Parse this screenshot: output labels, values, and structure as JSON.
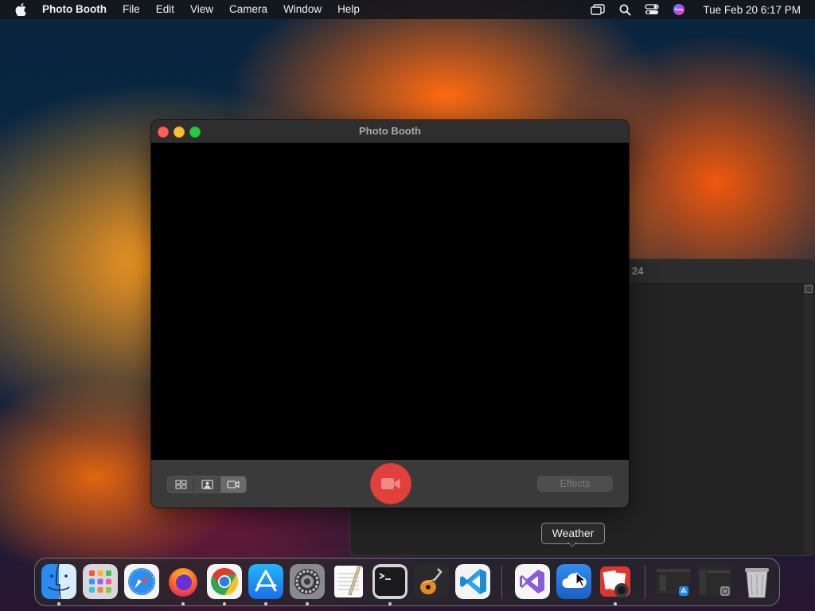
{
  "menubar": {
    "app_name": "Photo Booth",
    "menus": [
      "File",
      "Edit",
      "View",
      "Camera",
      "Window",
      "Help"
    ],
    "status_icons": [
      "screen-mirroring-icon",
      "search-icon",
      "control-center-icon",
      "siri-icon"
    ],
    "clock": "Tue Feb 20  6:17 PM"
  },
  "background_window": {
    "partial_title": "24"
  },
  "photo_booth": {
    "title": "Photo Booth",
    "modes": [
      {
        "name": "four-up-photo",
        "icon": "grid-icon",
        "active": false
      },
      {
        "name": "single-photo",
        "icon": "portrait-icon",
        "active": false
      },
      {
        "name": "video",
        "icon": "video-camera-icon",
        "active": true
      }
    ],
    "record_icon": "video-camera-icon",
    "effects_label": "Effects",
    "colors": {
      "record": "#e0413c",
      "close": "#fe5f57",
      "minimize": "#febc2e",
      "zoom": "#28c840"
    }
  },
  "tooltip": {
    "text": "Weather"
  },
  "dock": {
    "items": [
      {
        "name": "Finder",
        "icon": "finder-icon",
        "running": true
      },
      {
        "name": "Launchpad",
        "icon": "launchpad-icon",
        "running": false
      },
      {
        "name": "Safari",
        "icon": "safari-icon",
        "running": false
      },
      {
        "name": "Firefox",
        "icon": "firefox-icon",
        "running": true
      },
      {
        "name": "Google Chrome",
        "icon": "chrome-icon",
        "running": true
      },
      {
        "name": "App Store",
        "icon": "app-store-icon",
        "running": true
      },
      {
        "name": "System Settings",
        "icon": "settings-gear-icon",
        "running": true
      },
      {
        "name": "TextEdit",
        "icon": "textedit-icon",
        "running": false
      },
      {
        "name": "Terminal",
        "icon": "terminal-icon",
        "running": true
      },
      {
        "name": "GarageBand",
        "icon": "garageband-icon",
        "running": false
      },
      {
        "name": "Visual Studio Code",
        "icon": "vscode-icon",
        "running": false
      },
      {
        "name": "Visual Studio",
        "icon": "visual-studio-icon",
        "running": false
      },
      {
        "name": "Weather",
        "icon": "weather-icon",
        "running": false
      },
      {
        "name": "Photo Booth",
        "icon": "photo-booth-icon",
        "running": true
      },
      {
        "name": "App Store window",
        "icon": "minimized-window-icon",
        "running": false
      },
      {
        "name": "Settings window",
        "icon": "minimized-window-icon",
        "running": false
      },
      {
        "name": "Trash",
        "icon": "trash-icon",
        "running": false
      }
    ]
  }
}
